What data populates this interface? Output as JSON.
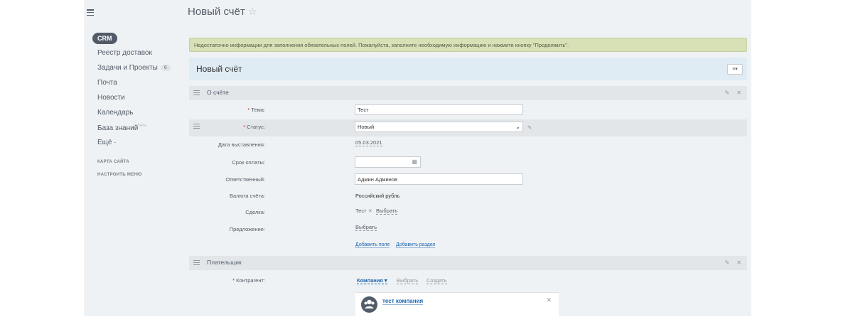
{
  "sidebar": {
    "crm_label": "CRM",
    "items": [
      {
        "label": "Реестр доставок"
      },
      {
        "label": "Задачи и Проекты",
        "count": "6"
      },
      {
        "label": "Почта"
      },
      {
        "label": "Новости"
      },
      {
        "label": "Календарь"
      },
      {
        "label": "База знаний",
        "badge": "beta"
      },
      {
        "label": "Ещё ·"
      }
    ],
    "sitemap_label": "КАРТА САЙТА",
    "settings_label": "НАСТРОИТЬ МЕНЮ"
  },
  "header": {
    "title": "Новый счёт"
  },
  "warning": {
    "text": "Недостаточно информации для заполнения обязательных полей. Пожалуйста, заполните необходимую информацию и нажмите кнопку \"Продолжить\"."
  },
  "form": {
    "title": "Новый счёт",
    "section_about": "О счёте",
    "fields": {
      "topic_label": "Тема:",
      "topic_value": "Тест",
      "status_label": "Статус:",
      "status_value": "Новый",
      "date_label": "Дата выставления:",
      "date_value": "05.03.2021",
      "due_label": "Срок оплаты:",
      "due_value": "",
      "responsible_label": "Ответственный:",
      "responsible_value": "Админ Админов",
      "currency_label": "Валюта счёта:",
      "currency_value": "Российский рубль",
      "deal_label": "Сделка:",
      "deal_value": "Тест",
      "deal_select": "Выбрать",
      "offer_label": "Предложение:",
      "offer_select": "Выбрать"
    },
    "add_field": "Добавить поле",
    "add_section": "Добавить раздел",
    "section_payer": "Плательщик",
    "payer": {
      "contractor_label": "Контрагент:",
      "company_label": "Компания",
      "select_label": "Выбрать",
      "create_label": "Создать",
      "client_name": "тест компания"
    }
  },
  "colors": {
    "accent": "#2067b0",
    "warning_bg": "#d8e0b6",
    "required": "#d0232a"
  }
}
